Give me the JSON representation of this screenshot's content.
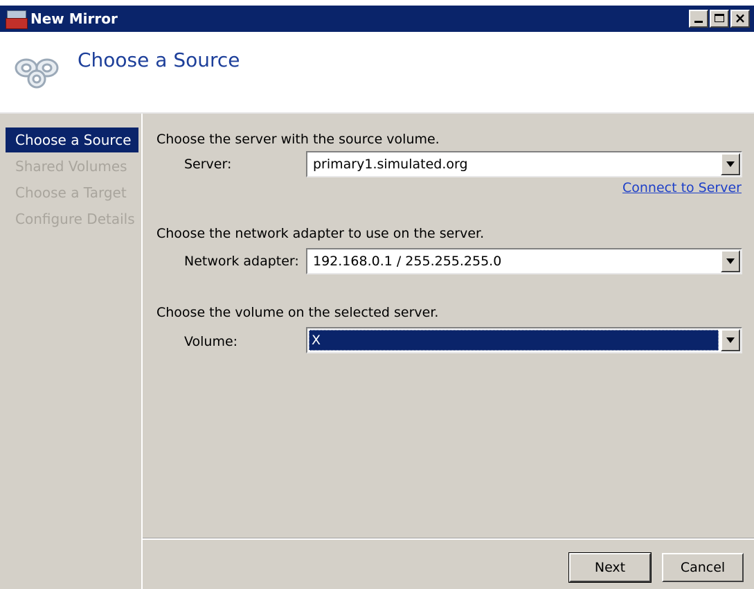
{
  "window": {
    "title": "New Mirror"
  },
  "header": {
    "title": "Choose a Source"
  },
  "nav": {
    "items": [
      {
        "label": "Choose a Source",
        "active": true
      },
      {
        "label": "Shared Volumes",
        "active": false
      },
      {
        "label": "Choose a Target",
        "active": false
      },
      {
        "label": "Configure Details",
        "active": false
      }
    ]
  },
  "server_section": {
    "prompt": "Choose the server with the source volume.",
    "label": "Server:",
    "value": "primary1.simulated.org",
    "link": "Connect to Server"
  },
  "adapter_section": {
    "prompt": "Choose the network adapter to use on the server.",
    "label": "Network adapter:",
    "value": "192.168.0.1 / 255.255.255.0"
  },
  "volume_section": {
    "prompt": "Choose the volume on the selected server.",
    "label": "Volume:",
    "value": "X"
  },
  "buttons": {
    "next": "Next",
    "cancel": "Cancel"
  },
  "colors": {
    "titlebar": "#0a246a",
    "selection": "#0a246a",
    "header_text": "#1d3f9a",
    "link": "#1d3fc8",
    "face": "#d4d0c8"
  },
  "icons": {
    "app": "mirror-app-icon",
    "header": "mirror-link-icon"
  }
}
